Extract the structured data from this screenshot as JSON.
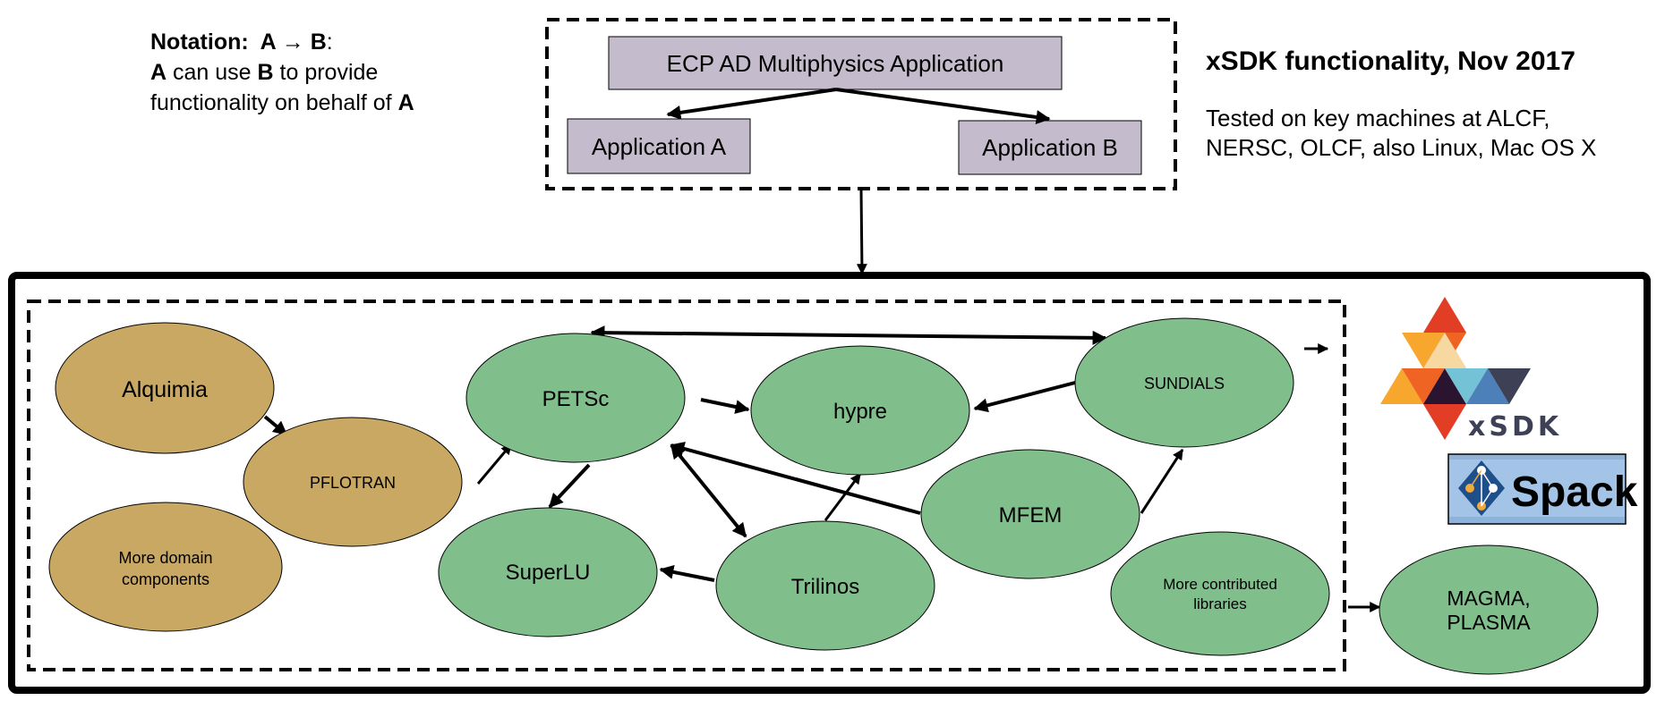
{
  "notation": {
    "heading": "Notation:",
    "a": "A",
    "arrow": "→",
    "b": "B",
    "colon": ":",
    "line2_a": "A",
    "line2_mid": " can use ",
    "line2_b": "B",
    "line2_end": " to provide",
    "line3_start": "functionality on behalf of ",
    "line3_a": "A"
  },
  "header": {
    "title": "xSDK functionality, Nov 2017",
    "subtitle_line1": "Tested on key machines at ALCF,",
    "subtitle_line2": "NERSC, OLCF, also Linux, Mac OS X"
  },
  "app_box": {
    "top": "ECP AD Multiphysics Application",
    "left": "Application A",
    "right": "Application B"
  },
  "nodes": {
    "alquimia": {
      "label": "Alquimia",
      "kind": "domain"
    },
    "pflotran": {
      "label": "PFLOTRAN",
      "kind": "domain"
    },
    "more_domain": {
      "label1": "More domain",
      "label2": "components",
      "kind": "domain"
    },
    "petsc": {
      "label": "PETSc",
      "kind": "library"
    },
    "hypre": {
      "label": "hypre",
      "kind": "library"
    },
    "sundials": {
      "label": "SUNDIALS",
      "kind": "library"
    },
    "superlu": {
      "label": "SuperLU",
      "kind": "library"
    },
    "trilinos": {
      "label": "Trilinos",
      "kind": "library"
    },
    "mfem": {
      "label": "MFEM",
      "kind": "library"
    },
    "more_contrib": {
      "label1": "More contributed",
      "label2": "libraries",
      "kind": "library"
    },
    "magma": {
      "label1": "MAGMA,",
      "label2": "PLASMA",
      "kind": "library"
    }
  },
  "edges": [
    {
      "from": "ECP AD Multiphysics Application",
      "to": "Application A"
    },
    {
      "from": "ECP AD Multiphysics Application",
      "to": "Application B"
    },
    {
      "from": "Application box",
      "to": "xSDK box"
    },
    {
      "from": "Alquimia",
      "to": "PFLOTRAN"
    },
    {
      "from": "PFLOTRAN",
      "to": "PETSc"
    },
    {
      "from": "PETSc",
      "to": "hypre"
    },
    {
      "from": "PETSc",
      "to": "SuperLU"
    },
    {
      "from": "PETSc",
      "to": "Trilinos",
      "bidirectional": true
    },
    {
      "from": "PETSc",
      "to": "SUNDIALS",
      "bidirectional": true
    },
    {
      "from": "SUNDIALS",
      "to": "hypre"
    },
    {
      "from": "Trilinos",
      "to": "hypre"
    },
    {
      "from": "Trilinos",
      "to": "SuperLU"
    },
    {
      "from": "MFEM",
      "to": "PETSc"
    },
    {
      "from": "MFEM",
      "to": "SUNDIALS"
    },
    {
      "from": "xSDK libraries",
      "to": "MAGMA, PLASMA"
    }
  ],
  "logos": {
    "xsdk_text": "xSDK",
    "spack_text": "Spack"
  },
  "colors": {
    "domain_fill": "#c8a862",
    "library_fill": "#80bf8c",
    "app_fill": "#c4bccc",
    "spack_bg": "#a3c4e6"
  }
}
